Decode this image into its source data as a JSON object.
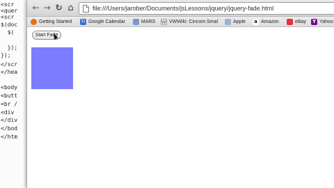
{
  "editor": {
    "lines": [
      "<scr",
      "<quer",
      "<scr",
      "$(doc",
      "  $(",
      "",
      "  });",
      "});",
      "</scr",
      "</hea",
      "",
      "<body",
      "<butt",
      "<br /",
      "<div",
      "</div",
      "</bod",
      "</htm"
    ]
  },
  "browser": {
    "nav": {
      "back_icon": "←",
      "forward_icon": "→",
      "reload_icon": "↻",
      "home_icon": "⌂"
    },
    "url": "file:///Users/jarober/Documents/jsLessons/jquery/jquery-fade.html"
  },
  "bookmarks": [
    {
      "label": "Getting Started",
      "icon_name": "firefox-icon",
      "color": "#e8701a",
      "glyph": ""
    },
    {
      "label": "Google Calendar",
      "icon_name": "calendar-icon",
      "color": "#3a6fd1",
      "glyph": "31"
    },
    {
      "label": "MARS",
      "icon_name": "mars-icon",
      "color": "#7a9ac8",
      "glyph": ""
    },
    {
      "label": "VWWiki: Cincom Smal",
      "icon_name": "wiki-icon",
      "color": "#ffffff",
      "glyph": "W"
    },
    {
      "label": "Apple",
      "icon_name": "folder-icon",
      "color": "#9ab4d6",
      "glyph": ""
    },
    {
      "label": "Amazon",
      "icon_name": "amazon-icon",
      "color": "#ffffff",
      "glyph": "a"
    },
    {
      "label": "eBay",
      "icon_name": "ebay-icon",
      "color": "#e53238",
      "glyph": ""
    },
    {
      "label": "Yahoo",
      "icon_name": "yahoo-icon",
      "color": "#7b0099",
      "glyph": "Y"
    }
  ],
  "page": {
    "start_button_label": "Start Fade",
    "box_color": "#7c7cff"
  }
}
